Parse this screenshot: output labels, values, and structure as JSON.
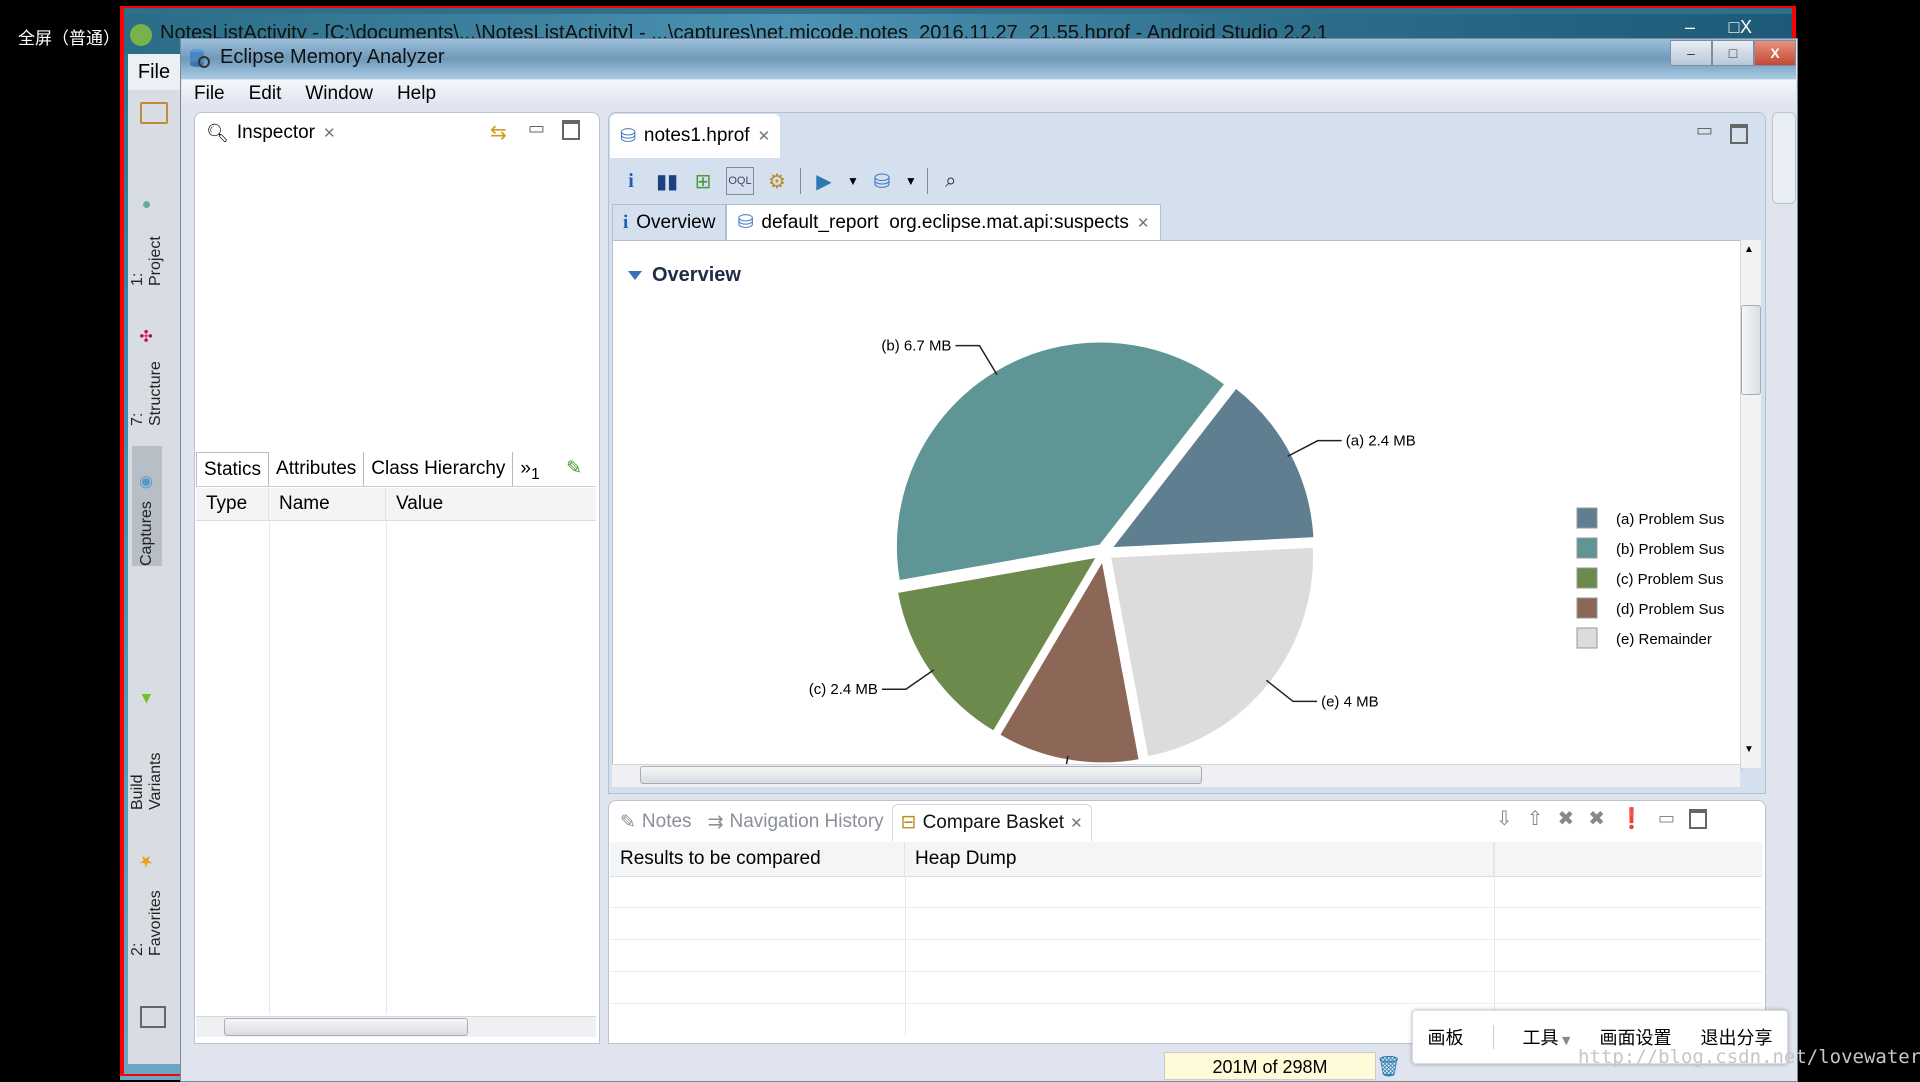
{
  "overlay_label": "全屏（普通）",
  "android_studio": {
    "title": "NotesListActivity - [C:\\documents\\...\\NotesListActivity] - ...\\captures\\net.micode.notes_2016.11.27_21.55.hprof - Android Studio 2.2.1",
    "menu_file": "File",
    "side_tabs": [
      "1: Project",
      "7: Structure",
      "Captures",
      "Build Variants",
      "2: Favorites"
    ],
    "ctrl_min": "–",
    "ctrl_max": "□",
    "ctrl_close": "X"
  },
  "mat": {
    "title": "Eclipse Memory Analyzer",
    "menu": [
      "File",
      "Edit",
      "Window",
      "Help"
    ],
    "window_controls": {
      "min": "–",
      "max": "□",
      "close": "X"
    },
    "inspector": {
      "tab_label": "Inspector",
      "subtabs": [
        "Statics",
        "Attributes",
        "Class Hierarchy"
      ],
      "overflow": "»",
      "overflow_count": "1",
      "columns": [
        "Type",
        "Name",
        "Value"
      ]
    },
    "editor": {
      "tab_label": "notes1.hprof",
      "toolbar_icons": [
        "info-icon",
        "histogram-icon",
        "dominator-tree-icon",
        "oql-icon",
        "thread-overview-icon",
        "run-report-icon",
        "query-browser-icon",
        "search-icon"
      ],
      "subtabs": [
        {
          "label": "Overview"
        },
        {
          "label": "default_report  org.eclipse.mat.api:suspects"
        }
      ],
      "section_heading": "Overview"
    },
    "bottom": {
      "tabs": [
        "Notes",
        "Navigation History",
        "Compare Basket"
      ],
      "active_tab": "Compare Basket",
      "columns": [
        "Results to be compared",
        "Heap Dump",
        ""
      ]
    },
    "status": {
      "memory": "201M of 298M"
    }
  },
  "share_toolbar": {
    "items": [
      "画板",
      "工具",
      "画面设置",
      "退出分享"
    ]
  },
  "watermark": "http://blog.csdn.net/lovewaterman",
  "chart_data": {
    "type": "pie",
    "title": "Overview",
    "unit": "MB",
    "slices": [
      {
        "key": "a",
        "label": "(a)  2.4 MB",
        "legend": "(a)  Problem Sus",
        "value": 2.4,
        "color": "#5f7f91"
      },
      {
        "key": "b",
        "label": "(b)  6.7 MB",
        "legend": "(b)  Problem Sus",
        "value": 6.7,
        "color": "#5f9595"
      },
      {
        "key": "c",
        "label": "(c)  2.4 MB",
        "legend": "(c)  Problem Sus",
        "value": 2.4,
        "color": "#6c8a4c"
      },
      {
        "key": "d",
        "label": "",
        "legend": "(d)  Problem Sus",
        "value": 2.0,
        "color": "#8c6657"
      },
      {
        "key": "e",
        "label": "(e)  4 MB",
        "legend": "(e)  Remainder",
        "value": 4.0,
        "color": "#dcdcdc"
      }
    ],
    "legend_position": "right"
  }
}
